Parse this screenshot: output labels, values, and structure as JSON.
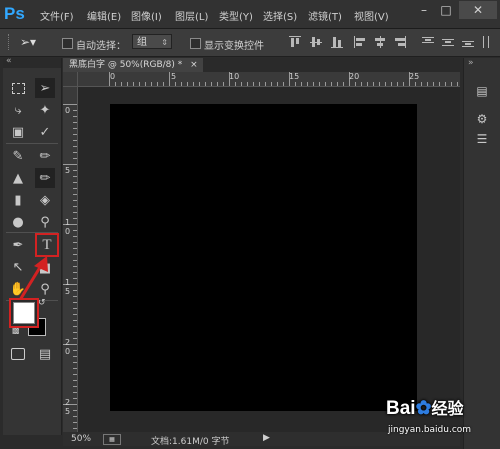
{
  "app": {
    "logo": "Ps"
  },
  "menu": [
    "文件(F)",
    "编辑(E)",
    "图像(I)",
    "图层(L)",
    "类型(Y)",
    "选择(S)",
    "滤镜(T)",
    "视图(V)"
  ],
  "options_bar": {
    "auto_select_label": "自动选择：",
    "auto_select_value": "组",
    "show_transform_label": "显示变换控件"
  },
  "document": {
    "tab_title": "黑底白字 @ 50%(RGB/8) *",
    "canvas_color": "#000000",
    "zoom": "50%",
    "doc_info": "文档:1.61M/0 字节"
  },
  "rulers": {
    "top": [
      "0",
      "5",
      "10",
      "15",
      "20",
      "25"
    ],
    "left": [
      "0",
      "5",
      "1",
      "0",
      "1",
      "5",
      "2",
      "0",
      "2",
      "5"
    ]
  },
  "colors": {
    "foreground": "#ffffff",
    "background": "#000000",
    "highlight": "#d32222"
  },
  "watermark": {
    "brand": "Bai",
    "brand2": "经验",
    "url": "jingyan.baidu.com"
  }
}
